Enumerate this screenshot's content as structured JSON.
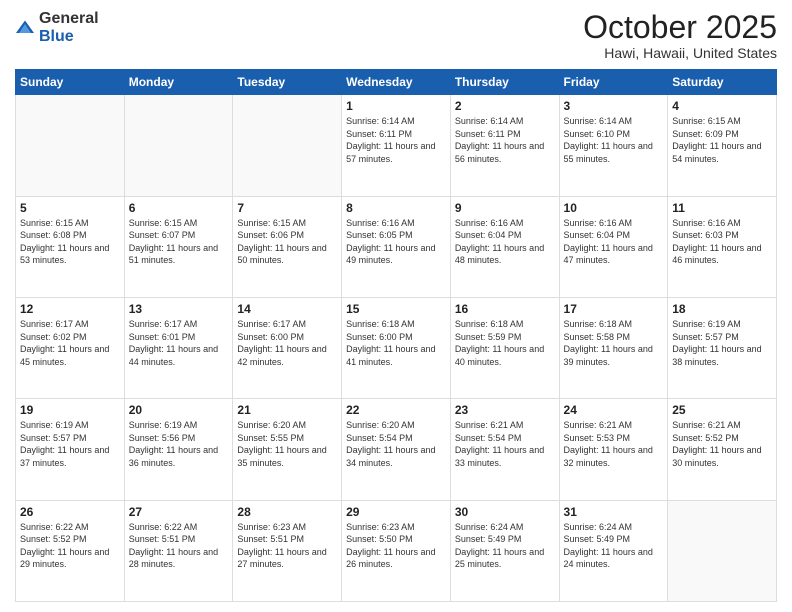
{
  "header": {
    "logo": {
      "text_general": "General",
      "text_blue": "Blue"
    },
    "month": "October 2025",
    "location": "Hawi, Hawaii, United States"
  },
  "weekdays": [
    "Sunday",
    "Monday",
    "Tuesday",
    "Wednesday",
    "Thursday",
    "Friday",
    "Saturday"
  ],
  "weeks": [
    [
      {
        "day": "",
        "empty": true
      },
      {
        "day": "",
        "empty": true
      },
      {
        "day": "",
        "empty": true
      },
      {
        "day": "1",
        "sunrise": "6:14 AM",
        "sunset": "6:11 PM",
        "daylight": "11 hours and 57 minutes."
      },
      {
        "day": "2",
        "sunrise": "6:14 AM",
        "sunset": "6:11 PM",
        "daylight": "11 hours and 56 minutes."
      },
      {
        "day": "3",
        "sunrise": "6:14 AM",
        "sunset": "6:10 PM",
        "daylight": "11 hours and 55 minutes."
      },
      {
        "day": "4",
        "sunrise": "6:15 AM",
        "sunset": "6:09 PM",
        "daylight": "11 hours and 54 minutes."
      }
    ],
    [
      {
        "day": "5",
        "sunrise": "6:15 AM",
        "sunset": "6:08 PM",
        "daylight": "11 hours and 53 minutes."
      },
      {
        "day": "6",
        "sunrise": "6:15 AM",
        "sunset": "6:07 PM",
        "daylight": "11 hours and 51 minutes."
      },
      {
        "day": "7",
        "sunrise": "6:15 AM",
        "sunset": "6:06 PM",
        "daylight": "11 hours and 50 minutes."
      },
      {
        "day": "8",
        "sunrise": "6:16 AM",
        "sunset": "6:05 PM",
        "daylight": "11 hours and 49 minutes."
      },
      {
        "day": "9",
        "sunrise": "6:16 AM",
        "sunset": "6:04 PM",
        "daylight": "11 hours and 48 minutes."
      },
      {
        "day": "10",
        "sunrise": "6:16 AM",
        "sunset": "6:04 PM",
        "daylight": "11 hours and 47 minutes."
      },
      {
        "day": "11",
        "sunrise": "6:16 AM",
        "sunset": "6:03 PM",
        "daylight": "11 hours and 46 minutes."
      }
    ],
    [
      {
        "day": "12",
        "sunrise": "6:17 AM",
        "sunset": "6:02 PM",
        "daylight": "11 hours and 45 minutes."
      },
      {
        "day": "13",
        "sunrise": "6:17 AM",
        "sunset": "6:01 PM",
        "daylight": "11 hours and 44 minutes."
      },
      {
        "day": "14",
        "sunrise": "6:17 AM",
        "sunset": "6:00 PM",
        "daylight": "11 hours and 42 minutes."
      },
      {
        "day": "15",
        "sunrise": "6:18 AM",
        "sunset": "6:00 PM",
        "daylight": "11 hours and 41 minutes."
      },
      {
        "day": "16",
        "sunrise": "6:18 AM",
        "sunset": "5:59 PM",
        "daylight": "11 hours and 40 minutes."
      },
      {
        "day": "17",
        "sunrise": "6:18 AM",
        "sunset": "5:58 PM",
        "daylight": "11 hours and 39 minutes."
      },
      {
        "day": "18",
        "sunrise": "6:19 AM",
        "sunset": "5:57 PM",
        "daylight": "11 hours and 38 minutes."
      }
    ],
    [
      {
        "day": "19",
        "sunrise": "6:19 AM",
        "sunset": "5:57 PM",
        "daylight": "11 hours and 37 minutes."
      },
      {
        "day": "20",
        "sunrise": "6:19 AM",
        "sunset": "5:56 PM",
        "daylight": "11 hours and 36 minutes."
      },
      {
        "day": "21",
        "sunrise": "6:20 AM",
        "sunset": "5:55 PM",
        "daylight": "11 hours and 35 minutes."
      },
      {
        "day": "22",
        "sunrise": "6:20 AM",
        "sunset": "5:54 PM",
        "daylight": "11 hours and 34 minutes."
      },
      {
        "day": "23",
        "sunrise": "6:21 AM",
        "sunset": "5:54 PM",
        "daylight": "11 hours and 33 minutes."
      },
      {
        "day": "24",
        "sunrise": "6:21 AM",
        "sunset": "5:53 PM",
        "daylight": "11 hours and 32 minutes."
      },
      {
        "day": "25",
        "sunrise": "6:21 AM",
        "sunset": "5:52 PM",
        "daylight": "11 hours and 30 minutes."
      }
    ],
    [
      {
        "day": "26",
        "sunrise": "6:22 AM",
        "sunset": "5:52 PM",
        "daylight": "11 hours and 29 minutes."
      },
      {
        "day": "27",
        "sunrise": "6:22 AM",
        "sunset": "5:51 PM",
        "daylight": "11 hours and 28 minutes."
      },
      {
        "day": "28",
        "sunrise": "6:23 AM",
        "sunset": "5:51 PM",
        "daylight": "11 hours and 27 minutes."
      },
      {
        "day": "29",
        "sunrise": "6:23 AM",
        "sunset": "5:50 PM",
        "daylight": "11 hours and 26 minutes."
      },
      {
        "day": "30",
        "sunrise": "6:24 AM",
        "sunset": "5:49 PM",
        "daylight": "11 hours and 25 minutes."
      },
      {
        "day": "31",
        "sunrise": "6:24 AM",
        "sunset": "5:49 PM",
        "daylight": "11 hours and 24 minutes."
      },
      {
        "day": "",
        "empty": true
      }
    ]
  ],
  "labels": {
    "sunrise": "Sunrise:",
    "sunset": "Sunset:",
    "daylight": "Daylight hours"
  }
}
